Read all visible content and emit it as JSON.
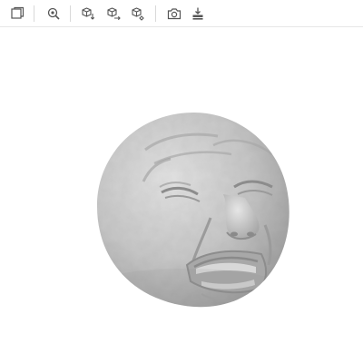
{
  "toolbar": {
    "buttons": [
      {
        "id": "reset-view",
        "icon": "fit-view-icon"
      },
      {
        "id": "zoom-region",
        "icon": "magnifier-zoom-icon"
      },
      {
        "id": "rotate-down",
        "icon": "cube-rotate-down-icon"
      },
      {
        "id": "rotate-right",
        "icon": "cube-rotate-right-icon"
      },
      {
        "id": "rotate-free",
        "icon": "cube-rotate-free-icon"
      },
      {
        "id": "screenshot",
        "icon": "camera-icon"
      },
      {
        "id": "download",
        "icon": "download-icon"
      }
    ]
  },
  "viewport": {
    "model": "grimacing-face-sphere",
    "background": "#ffffff",
    "model_color": "#bdbdbd"
  }
}
